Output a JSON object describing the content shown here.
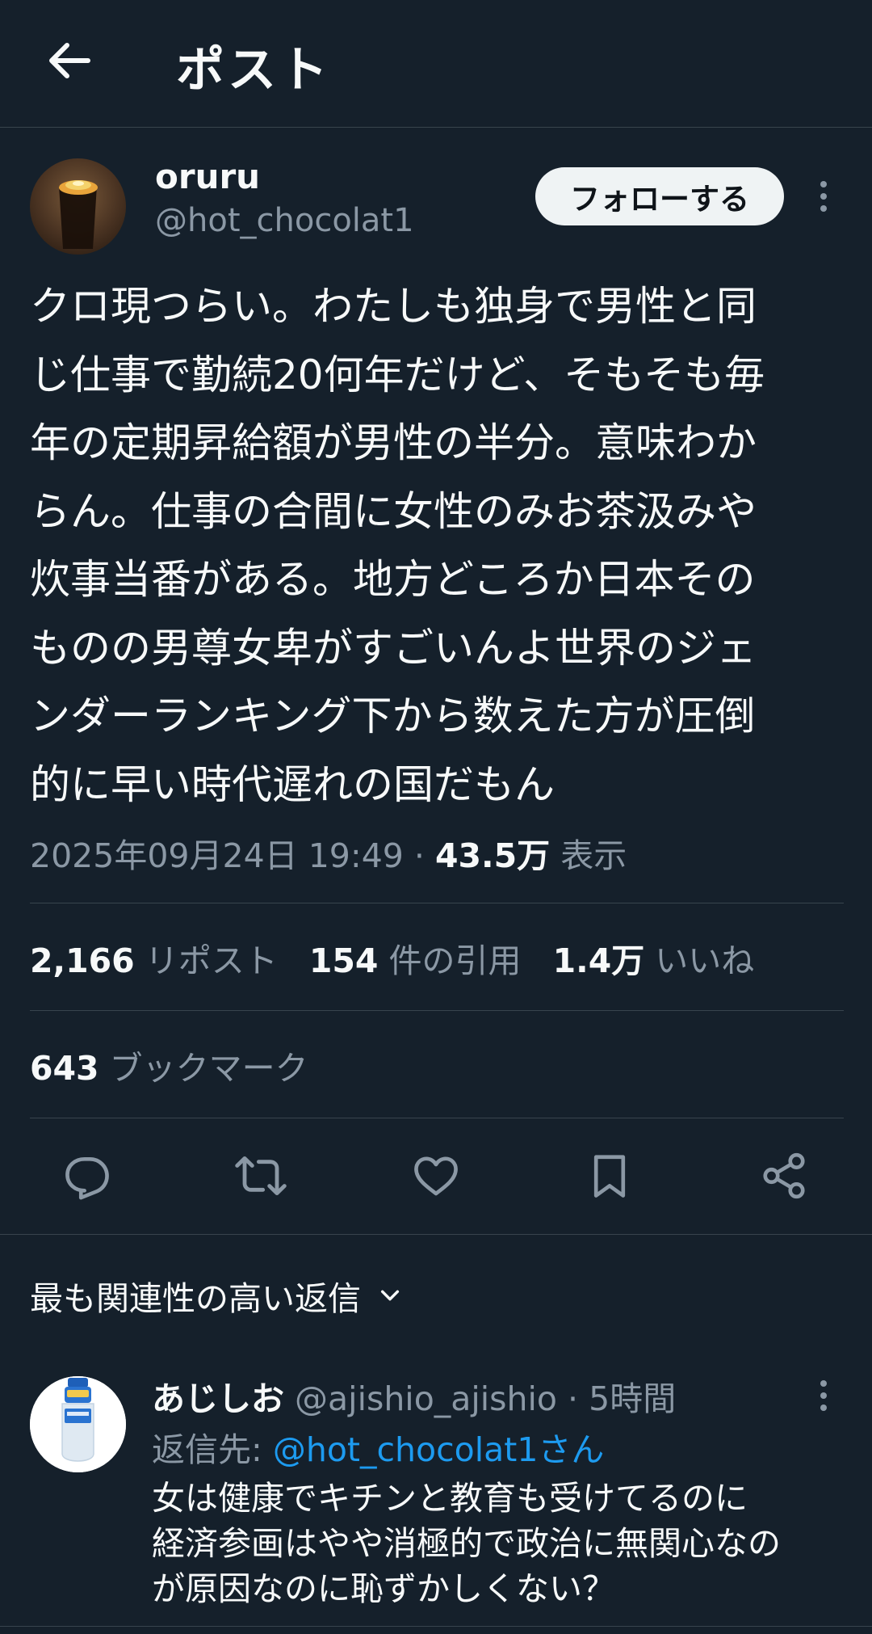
{
  "header": {
    "title": "ポスト",
    "back_icon": "arrow-left-icon"
  },
  "post": {
    "author": {
      "display_name": "oruru",
      "handle": "@hot_chocolat1",
      "avatar_icon": "iced-coffee-avatar"
    },
    "follow_label": "フォローする",
    "more_icon": "vertical-dots-icon",
    "text_lines": [
      "クロ現つらい。わたしも独身で男性と同",
      "じ仕事で勤続20何年だけど、そもそも毎",
      "年の定期昇給額が男性の半分。意味わか",
      "らん。仕事の合間に女性のみお茶汲みや",
      "炊事当番がある。地方どころか日本その",
      "ものの男尊女卑がすごいんよ世界のジェ",
      "ンダーランキング下から数えた方が圧倒",
      "的に早い時代遅れの国だもん"
    ],
    "timestamp": "2025年09月24日 19:49",
    "separator": " · ",
    "views_count": "43.5万",
    "views_label": " 表示",
    "stats": {
      "reposts_count": "2,166",
      "reposts_label": " リポスト",
      "quotes_count": "154",
      "quotes_label": " 件の引用",
      "likes_count": "1.4万",
      "likes_label": " いいね",
      "bookmarks_count": "643",
      "bookmarks_label": " ブックマーク"
    },
    "actions": [
      "reply-icon",
      "repost-icon",
      "like-icon",
      "bookmark-icon",
      "share-icon"
    ]
  },
  "replies_section": {
    "sort_label": "最も関連性の高い返信",
    "sort_icon": "chevron-down-icon"
  },
  "reply": {
    "display_name": "あじしお",
    "handle": "@ajishio_ajishio",
    "separator": " · ",
    "time": "5時間",
    "replying_prefix": "返信先: ",
    "replying_mention": "@hot_chocolat1さん",
    "text_lines": [
      "女は健康でキチンと教育も受けてるのに",
      "経済参画はやや消極的で政治に無関心なの",
      "が原因なのに恥ずかしくない？"
    ]
  },
  "colors": {
    "background": "#15202b",
    "divider": "#38444d",
    "text_primary": "#f7f9f9",
    "text_secondary": "#8b98a5",
    "link": "#1d9bf0",
    "follow_button_bg": "#eff3f4"
  }
}
